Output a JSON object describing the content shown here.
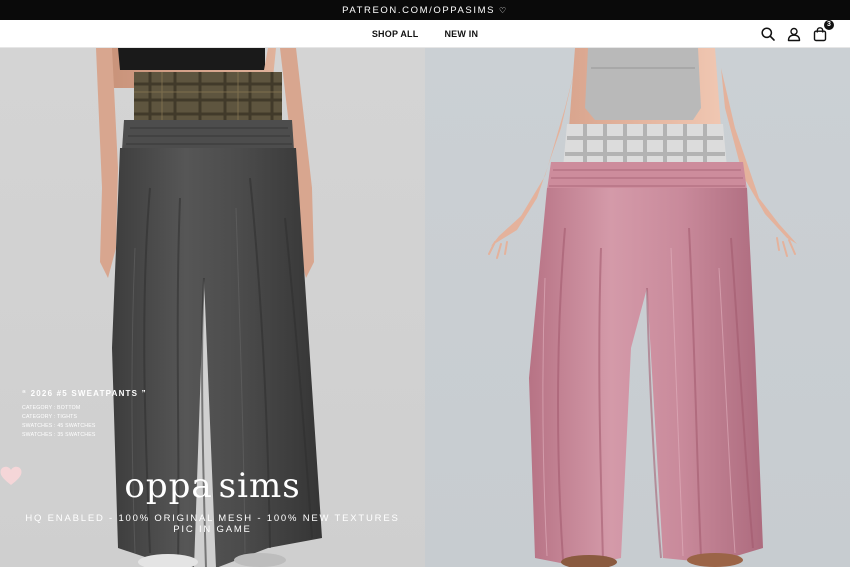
{
  "announcement": {
    "text": "PATREON.COM/OPPASIMS",
    "icon": "heart-outline-icon"
  },
  "nav": {
    "links": [
      "SHOP ALL",
      "NEW IN"
    ],
    "icons": [
      "search-icon",
      "account-icon",
      "cart-icon"
    ],
    "cart_count": "3"
  },
  "product": {
    "title": "“ 2026 #5 SWEATPANTS ”",
    "meta": [
      "CATEGORY : BOTTOM",
      "CATEGORY : TIGHTS",
      "SWATCHES : 45 SWATCHES",
      "SWATCHES : 35 SWATCHES"
    ]
  },
  "brand": {
    "left": "oppa",
    "right": "sims",
    "icon": "heart-logo-icon",
    "heart_color": "#f5d6d8"
  },
  "tagline": {
    "line1": "HQ ENABLED - 100% ORIGINAL MESH - 100% NEW TEXTURES",
    "line2": "PIC IN GAME"
  },
  "colors": {
    "left_pants": "#4a4a4a",
    "right_pants": "#c98a9b",
    "left_bg": "#d3d3d3",
    "right_bg": "#c9ced2"
  }
}
